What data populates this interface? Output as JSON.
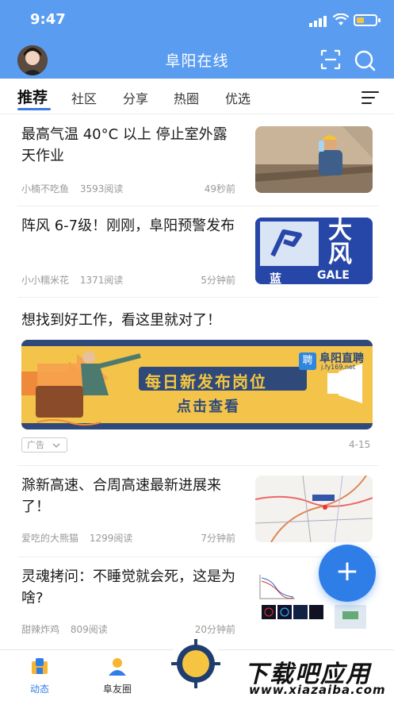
{
  "status_bar": {
    "time": "9:47"
  },
  "header": {
    "title": "阜阳在线",
    "icons": [
      "avatar",
      "scan-icon",
      "search-icon"
    ]
  },
  "tabs": [
    {
      "label": "推荐",
      "active": true
    },
    {
      "label": "社区"
    },
    {
      "label": "分享"
    },
    {
      "label": "热圈"
    },
    {
      "label": "优选"
    }
  ],
  "articles": [
    {
      "title": "最高气温 40°C 以上 停止室外露天作业",
      "author": "小楠不吃鱼",
      "reads": "3593阅读",
      "time": "49秒前"
    },
    {
      "title": "阵风 6-7级！刚刚，阜阳预警发布",
      "author": "小小糯米花",
      "reads": "1371阅读",
      "time": "5分钟前",
      "thumb_text": {
        "big": "大风",
        "sub": "GALE",
        "corner": "蓝"
      }
    },
    {
      "title": "滁新高速、合周高速最新进展来了！",
      "author": "爱吃的大熊猫",
      "reads": "1299阅读",
      "time": "7分钟前"
    },
    {
      "title": "灵魂拷问：不睡觉就会死，这是为啥?",
      "author": "甜辣炸鸡",
      "reads": "809阅读",
      "time": "20分钟前"
    }
  ],
  "ad": {
    "title": "想找到好工作，看这里就对了！",
    "brand": "阜阳直聘",
    "brand_url": "j.fy169.net",
    "brand_badge": "聘",
    "headline": "每日新发布岗位",
    "cta": "点击查看",
    "tag": "广告",
    "index": "4-15"
  },
  "fab": {
    "label": "+"
  },
  "bottom_nav": [
    {
      "label": "动态",
      "active": true
    },
    {
      "label": "阜友圈"
    }
  ],
  "watermark": {
    "big": "下载吧应用",
    "small": "www.xiazaiba.com"
  },
  "colors": {
    "primary": "#5a9df0",
    "accent": "#2f7ee8",
    "tab_underline": "#3a7be0",
    "ad_banner": "#f3c34a"
  }
}
